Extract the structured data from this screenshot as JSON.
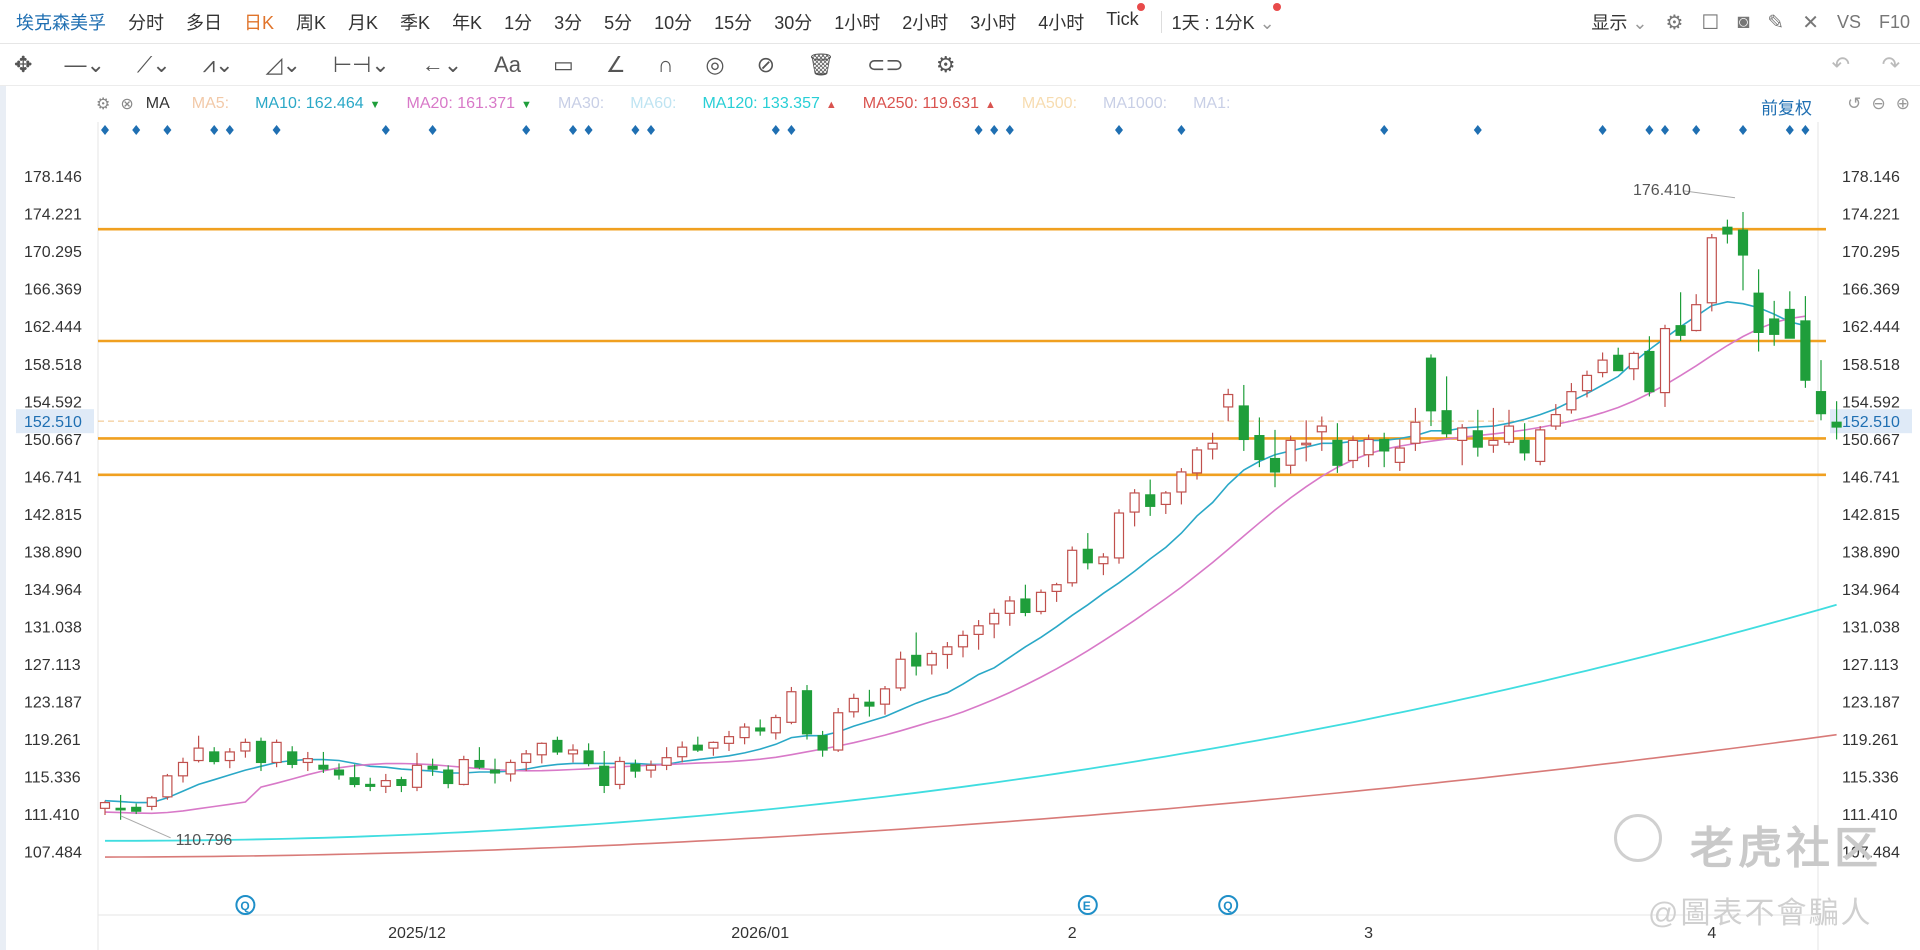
{
  "header": {
    "symbol": "埃克森美孚",
    "timeframes": [
      "分时",
      "多日",
      "日K",
      "周K",
      "月K",
      "季K",
      "年K",
      "1分",
      "3分",
      "5分",
      "10分",
      "15分",
      "30分",
      "1小时",
      "2小时",
      "3小时",
      "4小时",
      "Tick"
    ],
    "active_timeframe": "日K",
    "compare": "1天 : 1分K",
    "display_label": "显示",
    "vs_label": "VS",
    "f10_label": "F10"
  },
  "ma_bar": {
    "name": "MA",
    "items": [
      {
        "label": "MA5:",
        "value": "",
        "color": "#f2c9a8",
        "arrow": ""
      },
      {
        "label": "MA10:",
        "value": "162.464",
        "color": "#2aa8c7",
        "arrow": "down"
      },
      {
        "label": "MA20:",
        "value": "161.371",
        "color": "#d879c8",
        "arrow": "down"
      },
      {
        "label": "MA30:",
        "value": "",
        "color": "#c8cfe6",
        "arrow": ""
      },
      {
        "label": "MA60:",
        "value": "",
        "color": "#bfe4f2",
        "arrow": ""
      },
      {
        "label": "MA120:",
        "value": "133.357",
        "color": "#28cfd6",
        "arrow": "up"
      },
      {
        "label": "MA250:",
        "value": "119.631",
        "color": "#d9534f",
        "arrow": "up"
      },
      {
        "label": "MA500:",
        "value": "",
        "color": "#f7dcb0",
        "arrow": ""
      },
      {
        "label": "MA1000:",
        "value": "",
        "color": "#c8cfe6",
        "arrow": ""
      },
      {
        "label": "MA1:",
        "value": "",
        "color": "#c8cfe6",
        "arrow": ""
      }
    ],
    "price_mode": "前复权"
  },
  "chart_data": {
    "type": "candlestick",
    "y_ticks": [
      "178.146",
      "174.221",
      "170.295",
      "166.369",
      "162.444",
      "158.518",
      "154.592",
      "150.667",
      "146.741",
      "142.815",
      "138.890",
      "134.964",
      "131.038",
      "127.113",
      "123.187",
      "119.261",
      "115.336",
      "111.410",
      "107.484"
    ],
    "ylim": [
      104.5,
      181.2
    ],
    "x_labels": [
      {
        "label": "2025/12",
        "index": 20
      },
      {
        "label": "2026/01",
        "index": 42
      },
      {
        "label": "2",
        "index": 62
      },
      {
        "label": "3",
        "index": 81
      },
      {
        "label": "4",
        "index": 103
      }
    ],
    "last_price": "152.510",
    "high_label": "176.410",
    "low_label": "110.796",
    "support_resistance_lines": [
      172.6,
      160.9,
      150.7,
      146.9
    ],
    "candles": [
      [
        112.0,
        112.8,
        111.3,
        112.6
      ],
      [
        112.0,
        113.4,
        110.8,
        111.9
      ],
      [
        112.1,
        112.5,
        111.4,
        111.7
      ],
      [
        112.2,
        113.3,
        111.8,
        113.1
      ],
      [
        113.2,
        115.6,
        112.9,
        115.4
      ],
      [
        115.4,
        117.3,
        114.7,
        116.8
      ],
      [
        117.0,
        119.6,
        116.8,
        118.3
      ],
      [
        117.9,
        118.4,
        116.6,
        116.9
      ],
      [
        117.0,
        118.3,
        116.2,
        117.9
      ],
      [
        118.0,
        119.3,
        117.3,
        118.9
      ],
      [
        119.0,
        119.4,
        115.9,
        116.8
      ],
      [
        116.8,
        119.2,
        116.3,
        118.9
      ],
      [
        117.9,
        118.5,
        116.2,
        116.6
      ],
      [
        116.8,
        117.9,
        115.9,
        117.2
      ],
      [
        116.5,
        117.9,
        115.7,
        116.1
      ],
      [
        116.0,
        116.7,
        115.0,
        115.5
      ],
      [
        115.2,
        116.6,
        114.2,
        114.5
      ],
      [
        114.5,
        115.2,
        113.8,
        114.3
      ],
      [
        114.3,
        115.6,
        113.6,
        114.9
      ],
      [
        115.0,
        115.3,
        113.7,
        114.4
      ],
      [
        114.2,
        117.8,
        113.8,
        116.5
      ],
      [
        116.4,
        117.2,
        115.4,
        116.1
      ],
      [
        116.0,
        116.5,
        114.1,
        114.6
      ],
      [
        114.5,
        117.5,
        114.4,
        117.1
      ],
      [
        117.0,
        118.4,
        116.1,
        116.3
      ],
      [
        116.0,
        117.2,
        114.6,
        115.7
      ],
      [
        115.6,
        117.1,
        114.8,
        116.8
      ],
      [
        116.8,
        118.1,
        115.9,
        117.7
      ],
      [
        117.6,
        118.9,
        116.7,
        118.8
      ],
      [
        119.1,
        119.5,
        117.6,
        117.9
      ],
      [
        117.7,
        118.7,
        116.8,
        118.1
      ],
      [
        118.0,
        118.8,
        116.4,
        116.7
      ],
      [
        116.4,
        118.0,
        113.6,
        114.4
      ],
      [
        114.5,
        117.4,
        114.0,
        116.9
      ],
      [
        116.6,
        117.1,
        115.2,
        115.9
      ],
      [
        116.0,
        117.0,
        115.2,
        116.5
      ],
      [
        116.5,
        118.4,
        116.0,
        117.3
      ],
      [
        117.4,
        119.0,
        116.8,
        118.4
      ],
      [
        118.6,
        119.5,
        117.9,
        118.1
      ],
      [
        118.3,
        119.0,
        117.5,
        118.9
      ],
      [
        118.8,
        120.1,
        118.0,
        119.5
      ],
      [
        119.4,
        120.9,
        118.7,
        120.5
      ],
      [
        120.4,
        121.3,
        119.6,
        120.1
      ],
      [
        119.9,
        121.8,
        119.2,
        121.5
      ],
      [
        121.0,
        124.7,
        120.8,
        124.2
      ],
      [
        124.3,
        124.9,
        119.2,
        119.8
      ],
      [
        119.6,
        120.1,
        117.4,
        118.1
      ],
      [
        118.1,
        122.5,
        117.9,
        122.0
      ],
      [
        122.1,
        124.0,
        121.5,
        123.5
      ],
      [
        123.1,
        124.4,
        121.6,
        122.7
      ],
      [
        122.9,
        124.8,
        121.8,
        124.5
      ],
      [
        124.6,
        128.4,
        124.3,
        127.6
      ],
      [
        128.0,
        130.4,
        125.9,
        126.9
      ],
      [
        127.0,
        128.5,
        126.0,
        128.2
      ],
      [
        128.1,
        129.4,
        126.6,
        128.9
      ],
      [
        128.9,
        130.6,
        127.8,
        130.1
      ],
      [
        130.2,
        131.7,
        128.6,
        131.1
      ],
      [
        131.3,
        132.9,
        129.8,
        132.4
      ],
      [
        132.4,
        134.2,
        131.1,
        133.7
      ],
      [
        133.9,
        135.4,
        132.1,
        132.5
      ],
      [
        132.6,
        134.9,
        132.3,
        134.6
      ],
      [
        134.7,
        135.6,
        133.6,
        135.4
      ],
      [
        135.6,
        139.4,
        135.2,
        139.0
      ],
      [
        139.1,
        140.8,
        137.0,
        137.7
      ],
      [
        137.6,
        138.7,
        136.4,
        138.3
      ],
      [
        138.2,
        143.3,
        137.6,
        142.9
      ],
      [
        143.0,
        145.4,
        141.5,
        145.0
      ],
      [
        144.8,
        146.4,
        142.6,
        143.6
      ],
      [
        143.8,
        145.2,
        142.8,
        145.0
      ],
      [
        145.1,
        147.6,
        143.8,
        147.2
      ],
      [
        147.1,
        149.8,
        146.4,
        149.5
      ],
      [
        149.6,
        151.3,
        148.5,
        150.2
      ],
      [
        154.0,
        155.9,
        152.5,
        155.3
      ],
      [
        154.1,
        156.3,
        149.4,
        150.6
      ],
      [
        151.0,
        152.9,
        147.7,
        148.5
      ],
      [
        148.6,
        151.6,
        145.6,
        147.2
      ],
      [
        147.9,
        151.0,
        147.0,
        150.5
      ],
      [
        150.1,
        152.6,
        148.3,
        150.2
      ],
      [
        151.4,
        153.0,
        149.4,
        152.0
      ],
      [
        150.5,
        152.3,
        147.1,
        147.9
      ],
      [
        148.4,
        151.0,
        147.6,
        150.5
      ],
      [
        149.0,
        151.1,
        147.7,
        150.6
      ],
      [
        150.6,
        151.3,
        147.7,
        149.4
      ],
      [
        148.2,
        150.6,
        147.3,
        149.7
      ],
      [
        150.2,
        153.9,
        149.4,
        152.4
      ],
      [
        159.1,
        159.5,
        152.0,
        153.6
      ],
      [
        153.6,
        157.2,
        150.8,
        151.2
      ],
      [
        150.5,
        152.2,
        147.9,
        151.8
      ],
      [
        151.5,
        153.7,
        148.8,
        149.8
      ],
      [
        150.0,
        153.9,
        149.2,
        150.5
      ],
      [
        150.3,
        153.7,
        150.0,
        152.0
      ],
      [
        150.5,
        152.3,
        148.4,
        149.2
      ],
      [
        148.3,
        152.0,
        147.9,
        151.6
      ],
      [
        152.0,
        154.3,
        151.6,
        153.2
      ],
      [
        153.7,
        156.5,
        153.3,
        155.6
      ],
      [
        155.7,
        157.8,
        155.0,
        157.3
      ],
      [
        157.6,
        159.7,
        157.1,
        158.9
      ],
      [
        159.4,
        160.2,
        157.8,
        157.8
      ],
      [
        158.0,
        159.8,
        156.8,
        159.6
      ],
      [
        159.8,
        161.4,
        155.1,
        155.6
      ],
      [
        155.5,
        162.6,
        154.0,
        162.2
      ],
      [
        162.5,
        166.0,
        160.9,
        161.5
      ],
      [
        162.0,
        165.8,
        161.9,
        164.7
      ],
      [
        164.9,
        172.1,
        164.0,
        171.7
      ],
      [
        172.8,
        173.6,
        171.1,
        172.1
      ],
      [
        172.5,
        174.4,
        166.2,
        169.9
      ],
      [
        165.9,
        168.4,
        159.8,
        161.8
      ],
      [
        163.2,
        165.1,
        160.4,
        161.6
      ],
      [
        164.2,
        166.1,
        162.4,
        161.2
      ],
      [
        163.0,
        165.6,
        156.0,
        156.8
      ],
      [
        155.6,
        158.9,
        152.6,
        153.3
      ],
      [
        152.4,
        154.6,
        150.6,
        151.9
      ]
    ],
    "ma10": [
      112.8,
      112.7,
      112.6,
      112.6,
      113.1,
      113.8,
      114.5,
      115.0,
      115.5,
      116.0,
      116.4,
      116.8,
      117.0,
      117.1,
      117.1,
      117.0,
      116.7,
      116.4,
      116.3,
      116.1,
      116.0,
      115.9,
      115.7,
      115.7,
      115.8,
      115.8,
      115.9,
      116.1,
      116.4,
      116.6,
      116.7,
      116.7,
      116.7,
      116.7,
      116.7,
      116.6,
      116.6,
      116.9,
      117.1,
      117.3,
      117.5,
      117.8,
      118.2,
      118.7,
      119.4,
      119.6,
      119.6,
      120.0,
      120.6,
      121.1,
      121.6,
      122.3,
      123.0,
      123.6,
      124.1,
      125.0,
      126.0,
      126.7,
      127.8,
      128.9,
      129.9,
      131.0,
      132.2,
      133.3,
      134.5,
      135.6,
      136.8,
      138.1,
      139.3,
      140.8,
      142.6,
      144.0,
      145.9,
      147.4,
      148.3,
      149.0,
      149.4,
      149.8,
      150.2,
      150.2,
      150.4,
      150.5,
      150.5,
      150.7,
      151.0,
      151.5,
      151.5,
      151.8,
      151.9,
      152.0,
      152.3,
      152.7,
      153.2,
      153.8,
      154.6,
      155.4,
      156.3,
      157.2,
      158.7,
      160.0,
      161.2,
      162.4,
      163.5,
      164.6,
      165.0,
      164.8,
      164.4,
      163.7,
      162.9,
      162.5
    ]
  },
  "markers": {
    "top_dots": [
      0,
      2,
      4,
      7,
      8,
      11,
      18,
      21,
      27,
      30,
      31,
      34,
      35,
      43,
      44,
      56,
      57,
      58,
      65,
      69,
      82,
      88,
      96,
      99,
      100,
      102,
      105,
      108,
      109
    ],
    "bottom_events": [
      {
        "glyph": "Q",
        "index": 9
      },
      {
        "glyph": "E",
        "index": 63
      },
      {
        "glyph": "Q",
        "index": 72
      }
    ]
  },
  "watermark": {
    "brand": "老虎社区",
    "author": "@圖表不會騙人"
  },
  "colors": {
    "up": "#c0504d",
    "down": "#1f9e3b",
    "level": "#f0a020",
    "ma10": "#2aa8c7",
    "ma20": "#d879c8",
    "ma120": "#40dde0",
    "ma250": "#d87a78"
  }
}
